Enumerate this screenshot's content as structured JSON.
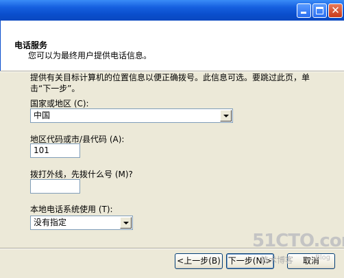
{
  "header": {
    "title": "电话服务",
    "subtitle": "您可以为最终用户提供电话信息。"
  },
  "intro": "提供有关目标计算机的位置信息以便正确拨号。此信息可选。要跳过此页，单击“下一步”。",
  "country": {
    "label": "国家或地区 (C):",
    "value": "中国"
  },
  "area_code": {
    "label": "地区代码或市/县代码 (A):",
    "value": "101"
  },
  "outside_line": {
    "label": "拨打外线，先拨什么号 (M)?",
    "value": ""
  },
  "phone_system": {
    "label": "本地电话系统使用 (T):",
    "value": "没有指定"
  },
  "buttons": {
    "back": "<上一步(B)",
    "next": "下一步(N)>",
    "cancel": "取消"
  },
  "watermark": {
    "main": "51CTO.com",
    "sub": "技术博客",
    "blog": "Blog"
  },
  "colors": {
    "titlebar": "#0a4ecc",
    "dialog_bg": "#ece9d8",
    "field_border": "#7f9db9"
  }
}
